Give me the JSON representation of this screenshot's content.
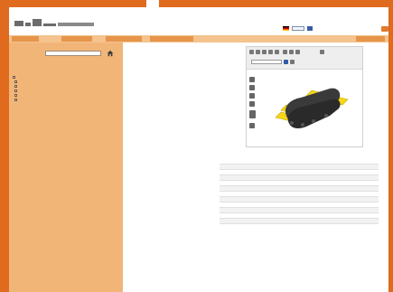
{
  "header": {
    "language": {
      "label": "",
      "selected": ""
    }
  },
  "navbar": {
    "buttons": [
      "",
      "",
      "",
      "",
      ""
    ]
  },
  "sidebar": {
    "search_label": "",
    "search_value": "",
    "subline": "",
    "tree": [
      {
        "label": "",
        "level": 0
      },
      {
        "label": "",
        "level": 1
      },
      {
        "label": "",
        "level": 1
      },
      {
        "label": "",
        "level": 1
      },
      {
        "label": "",
        "level": 1
      },
      {
        "label": "",
        "level": 1
      }
    ],
    "footer": ""
  },
  "viewer": {
    "toolbar": {
      "view_label": "",
      "mode_label": "",
      "mode_value": ""
    }
  },
  "table": {
    "rows": [
      {
        "name": "",
        "value": ""
      },
      {
        "name": "",
        "value": ""
      },
      {
        "name": "",
        "value": ""
      },
      {
        "name": "",
        "value": ""
      },
      {
        "name": "",
        "value": ""
      },
      {
        "name": "",
        "value": ""
      },
      {
        "name": "",
        "value": ""
      },
      {
        "name": "",
        "value": ""
      },
      {
        "name": "",
        "value": ""
      },
      {
        "name": "",
        "value": ""
      },
      {
        "name": "",
        "value": ""
      },
      {
        "name": "",
        "value": ""
      }
    ]
  },
  "colors": {
    "accent": "#e06a1e",
    "sidebar": "#f2b578",
    "navbar": "#f4c38e"
  },
  "icons": [
    "home-icon",
    "flag-icon",
    "print-icon",
    "zoom-icon",
    "rotate-icon",
    "settings-icon"
  ]
}
